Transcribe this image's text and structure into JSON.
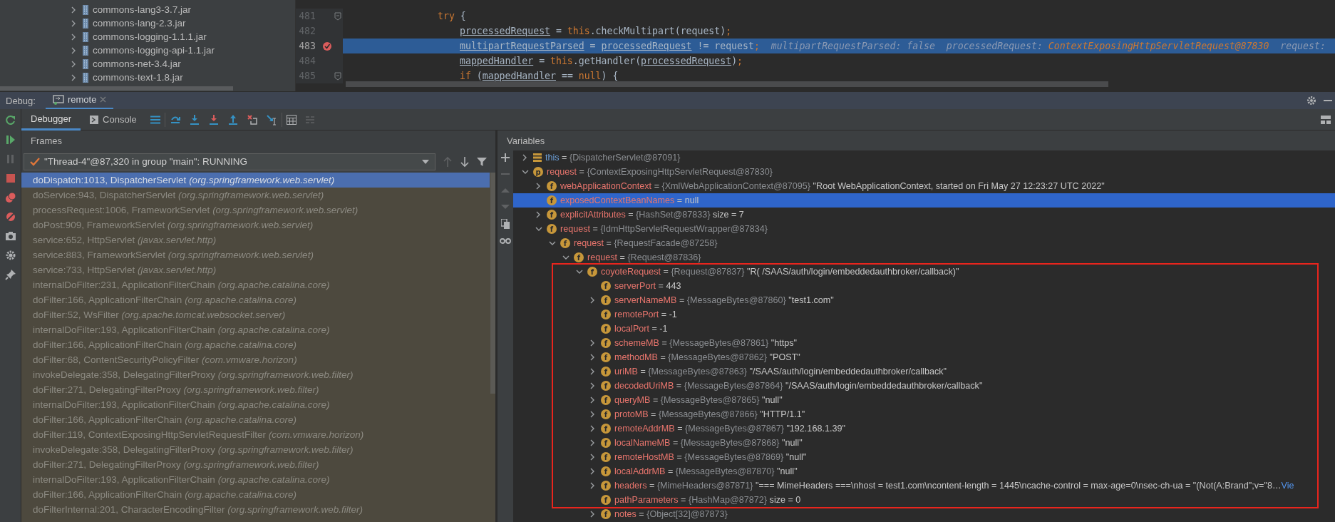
{
  "project_tree": {
    "items": [
      {
        "name": "commons-lang3-3.7.jar",
        "expanded": false
      },
      {
        "name": "commons-lang-2.3.jar",
        "expanded": false
      },
      {
        "name": "commons-logging-1.1.1.jar",
        "expanded": false
      },
      {
        "name": "commons-logging-api-1.1.jar",
        "expanded": false
      },
      {
        "name": "commons-net-3.4.jar",
        "expanded": false
      },
      {
        "name": "commons-text-1.8.jar",
        "expanded": false
      }
    ]
  },
  "editor": {
    "lines": [
      {
        "number": "481",
        "kind": "outer",
        "breakpoint": false,
        "current": false,
        "foldable": true,
        "tokens": [
          {
            "text": "try",
            "kind": "keyword"
          },
          {
            "text": " {",
            "kind": "plain"
          }
        ]
      },
      {
        "number": "482",
        "kind": "inner",
        "breakpoint": false,
        "current": false,
        "foldable": false,
        "tokens": [
          {
            "text": "processedRequest",
            "kind": "var"
          },
          {
            "text": " = ",
            "kind": "plain"
          },
          {
            "text": "this",
            "kind": "keyword"
          },
          {
            "text": ".checkMultipart(request)",
            "kind": "plain"
          },
          {
            "text": ";",
            "kind": "punct"
          }
        ]
      },
      {
        "number": "483",
        "kind": "inner",
        "breakpoint": true,
        "current": true,
        "foldable": false,
        "tokens": [
          {
            "text": "multipartRequestParsed",
            "kind": "var"
          },
          {
            "text": " = ",
            "kind": "plain"
          },
          {
            "text": "processedRequest",
            "kind": "var"
          },
          {
            "text": " != request",
            "kind": "plain"
          },
          {
            "text": ";",
            "kind": "punct"
          },
          {
            "text": "  multipartRequestParsed: false  processedRequest: ",
            "kind": "hint"
          },
          {
            "text": "ContextExposingHttpServletRequest@87830",
            "kind": "hint-ref"
          },
          {
            "text": "  request:",
            "kind": "hint"
          }
        ]
      },
      {
        "number": "484",
        "kind": "inner",
        "breakpoint": false,
        "current": false,
        "foldable": false,
        "tokens": [
          {
            "text": "mappedHandler",
            "kind": "var"
          },
          {
            "text": " = ",
            "kind": "plain"
          },
          {
            "text": "this",
            "kind": "keyword"
          },
          {
            "text": ".getHandler(",
            "kind": "plain"
          },
          {
            "text": "processedRequest",
            "kind": "var"
          },
          {
            "text": ")",
            "kind": "plain"
          },
          {
            "text": ";",
            "kind": "punct"
          }
        ]
      },
      {
        "number": "485",
        "kind": "inner",
        "breakpoint": false,
        "current": false,
        "foldable": true,
        "tokens": [
          {
            "text": "if",
            "kind": "keyword"
          },
          {
            "text": " (",
            "kind": "plain"
          },
          {
            "text": "mappedHandler",
            "kind": "var"
          },
          {
            "text": " == ",
            "kind": "plain"
          },
          {
            "text": "null",
            "kind": "keyword"
          },
          {
            "text": ") {",
            "kind": "plain"
          }
        ]
      }
    ]
  },
  "debug_bar": {
    "label": "Debug:",
    "tabs": [
      {
        "label": "remote",
        "selected": true
      }
    ]
  },
  "toolbar": {
    "tabs": [
      {
        "label": "Debugger",
        "selected": true
      },
      {
        "label": "Console",
        "selected": false
      }
    ]
  },
  "frames": {
    "title": "Frames",
    "thread": "\"Thread-4\"@87,320 in group \"main\": RUNNING",
    "items": [
      {
        "text": "doDispatch:1013, DispatcherServlet *(org.springframework.web.servlet)*",
        "selected": true
      },
      {
        "text": "doService:943, DispatcherServlet *(org.springframework.web.servlet)*",
        "selected": false
      },
      {
        "text": "processRequest:1006, FrameworkServlet *(org.springframework.web.servlet)*",
        "selected": false
      },
      {
        "text": "doPost:909, FrameworkServlet *(org.springframework.web.servlet)*",
        "selected": false
      },
      {
        "text": "service:652, HttpServlet *(javax.servlet.http)*",
        "selected": false
      },
      {
        "text": "service:883, FrameworkServlet *(org.springframework.web.servlet)*",
        "selected": false
      },
      {
        "text": "service:733, HttpServlet *(javax.servlet.http)*",
        "selected": false
      },
      {
        "text": "internalDoFilter:231, ApplicationFilterChain *(org.apache.catalina.core)*",
        "selected": false
      },
      {
        "text": "doFilter:166, ApplicationFilterChain *(org.apache.catalina.core)*",
        "selected": false
      },
      {
        "text": "doFilter:52, WsFilter *(org.apache.tomcat.websocket.server)*",
        "selected": false
      },
      {
        "text": "internalDoFilter:193, ApplicationFilterChain *(org.apache.catalina.core)*",
        "selected": false
      },
      {
        "text": "doFilter:166, ApplicationFilterChain *(org.apache.catalina.core)*",
        "selected": false
      },
      {
        "text": "doFilter:68, ContentSecurityPolicyFilter *(com.vmware.horizon)*",
        "selected": false
      },
      {
        "text": "invokeDelegate:358, DelegatingFilterProxy *(org.springframework.web.filter)*",
        "selected": false
      },
      {
        "text": "doFilter:271, DelegatingFilterProxy *(org.springframework.web.filter)*",
        "selected": false
      },
      {
        "text": "internalDoFilter:193, ApplicationFilterChain *(org.apache.catalina.core)*",
        "selected": false
      },
      {
        "text": "doFilter:166, ApplicationFilterChain *(org.apache.catalina.core)*",
        "selected": false
      },
      {
        "text": "doFilter:119, ContextExposingHttpServletRequestFilter *(com.vmware.horizon)*",
        "selected": false
      },
      {
        "text": "invokeDelegate:358, DelegatingFilterProxy *(org.springframework.web.filter)*",
        "selected": false
      },
      {
        "text": "doFilter:271, DelegatingFilterProxy *(org.springframework.web.filter)*",
        "selected": false
      },
      {
        "text": "internalDoFilter:193, ApplicationFilterChain *(org.apache.catalina.core)*",
        "selected": false
      },
      {
        "text": "doFilter:166, ApplicationFilterChain *(org.apache.catalina.core)*",
        "selected": false
      },
      {
        "text": "doFilterInternal:201, CharacterEncodingFilter *(org.springframework.web.filter)*",
        "selected": false
      }
    ]
  },
  "variables": {
    "title": "Variables",
    "annotation_box": true,
    "items": [
      {
        "kind": "object",
        "name": "this",
        "equals": "=",
        "type": "{DispatcherServlet@87091}",
        "expanded": false,
        "selected": false
      },
      {
        "kind": "param",
        "badge": "p",
        "name": "request",
        "equals": "=",
        "type": "{ContextExposingHttpServletRequest@87830}",
        "expanded": true,
        "selected": false,
        "children": [
          {
            "kind": "field",
            "badge": "f",
            "name": "webApplicationContext",
            "equals": "=",
            "type": "{XmlWebApplicationContext@87095}",
            "value": "\"Root WebApplicationContext, started on Fri May 27 12:23:27 UTC 2022\"",
            "expanded": false,
            "selected": false
          },
          {
            "kind": "field",
            "badge": "f",
            "name": "exposedContextBeanNames",
            "equals": "=",
            "value": "null",
            "selected": true
          },
          {
            "kind": "field",
            "badge": "f",
            "name": "explicitAttributes",
            "equals": "=",
            "type": "{HashSet@87833}",
            "value": " size = 7",
            "expanded": false,
            "selected": false
          },
          {
            "kind": "field",
            "badge": "f",
            "name": "request",
            "equals": "=",
            "type": "{IdmHttpServletRequestWrapper@87834}",
            "expanded": true,
            "selected": false,
            "children": [
              {
                "kind": "field",
                "badge": "f",
                "name": "request",
                "equals": "=",
                "type": "{RequestFacade@87258}",
                "expanded": true,
                "selected": false,
                "children": [
                  {
                    "kind": "field",
                    "badge": "f",
                    "name": "request",
                    "equals": "=",
                    "type": "{Request@87836}",
                    "expanded": true,
                    "selected": false,
                    "children": [
                      {
                        "kind": "field",
                        "badge": "f",
                        "name": "coyoteRequest",
                        "equals": "=",
                        "type": "{Request@87837}",
                        "value": "\"R( /SAAS/auth/login/embeddedauthbroker/callback)\"",
                        "expanded": true,
                        "selected": false,
                        "boxed": true,
                        "children": [
                          {
                            "kind": "field",
                            "badge": "f",
                            "name": "serverPort",
                            "equals": "=",
                            "value": "443",
                            "selected": false
                          },
                          {
                            "kind": "field",
                            "badge": "f",
                            "name": "serverNameMB",
                            "equals": "=",
                            "type": "{MessageBytes@87860}",
                            "value": "\"test1.com\"",
                            "expanded": false,
                            "selected": false
                          },
                          {
                            "kind": "field",
                            "badge": "f",
                            "name": "remotePort",
                            "equals": "=",
                            "value": "-1",
                            "selected": false
                          },
                          {
                            "kind": "field",
                            "badge": "f",
                            "name": "localPort",
                            "equals": "=",
                            "value": "-1",
                            "selected": false
                          },
                          {
                            "kind": "field",
                            "badge": "f",
                            "name": "schemeMB",
                            "equals": "=",
                            "type": "{MessageBytes@87861}",
                            "value": "\"https\"",
                            "expanded": false,
                            "selected": false
                          },
                          {
                            "kind": "field",
                            "badge": "f",
                            "name": "methodMB",
                            "equals": "=",
                            "type": "{MessageBytes@87862}",
                            "value": "\"POST\"",
                            "expanded": false,
                            "selected": false
                          },
                          {
                            "kind": "field",
                            "badge": "f",
                            "name": "uriMB",
                            "equals": "=",
                            "type": "{MessageBytes@87863}",
                            "value": "\"/SAAS/auth/login/embeddedauthbroker/callback\"",
                            "expanded": false,
                            "selected": false
                          },
                          {
                            "kind": "field",
                            "badge": "f",
                            "name": "decodedUriMB",
                            "equals": "=",
                            "type": "{MessageBytes@87864}",
                            "value": "\"/SAAS/auth/login/embeddedauthbroker/callback\"",
                            "expanded": false,
                            "selected": false
                          },
                          {
                            "kind": "field",
                            "badge": "f",
                            "name": "queryMB",
                            "equals": "=",
                            "type": "{MessageBytes@87865}",
                            "value": "\"null\"",
                            "expanded": false,
                            "selected": false
                          },
                          {
                            "kind": "field",
                            "badge": "f",
                            "name": "protoMB",
                            "equals": "=",
                            "type": "{MessageBytes@87866}",
                            "value": "\"HTTP/1.1\"",
                            "expanded": false,
                            "selected": false
                          },
                          {
                            "kind": "field",
                            "badge": "f",
                            "name": "remoteAddrMB",
                            "equals": "=",
                            "type": "{MessageBytes@87867}",
                            "value": "\"192.168.1.39\"",
                            "expanded": false,
                            "selected": false
                          },
                          {
                            "kind": "field",
                            "badge": "f",
                            "name": "localNameMB",
                            "equals": "=",
                            "type": "{MessageBytes@87868}",
                            "value": "\"null\"",
                            "expanded": false,
                            "selected": false
                          },
                          {
                            "kind": "field",
                            "badge": "f",
                            "name": "remoteHostMB",
                            "equals": "=",
                            "type": "{MessageBytes@87869}",
                            "value": "\"null\"",
                            "expanded": false,
                            "selected": false
                          },
                          {
                            "kind": "field",
                            "badge": "f",
                            "name": "localAddrMB",
                            "equals": "=",
                            "type": "{MessageBytes@87870}",
                            "value": "\"null\"",
                            "expanded": false,
                            "selected": false
                          },
                          {
                            "kind": "field",
                            "badge": "f",
                            "name": "headers",
                            "equals": "=",
                            "type": "{MimeHeaders@87871}",
                            "value": "\"=== MimeHeaders ===\\nhost = test1.com\\ncontent-length = 1445\\ncache-control = max-age=0\\nsec-ch-ua = \"(Not(A:Brand\";v=\"8…",
                            "link": "Vie",
                            "expanded": false,
                            "selected": false
                          },
                          {
                            "kind": "field",
                            "badge": "f",
                            "name": "pathParameters",
                            "equals": "=",
                            "type": "{HashMap@87872}",
                            "value": " size = 0",
                            "selected": false
                          },
                          {
                            "kind": "field",
                            "badge": "f",
                            "name": "notes",
                            "equals": "=",
                            "type": "{Object[32]@87873}",
                            "expanded": false,
                            "selected": false
                          }
                        ]
                      }
                    ]
                  }
                ]
              }
            ]
          }
        ]
      }
    ]
  }
}
